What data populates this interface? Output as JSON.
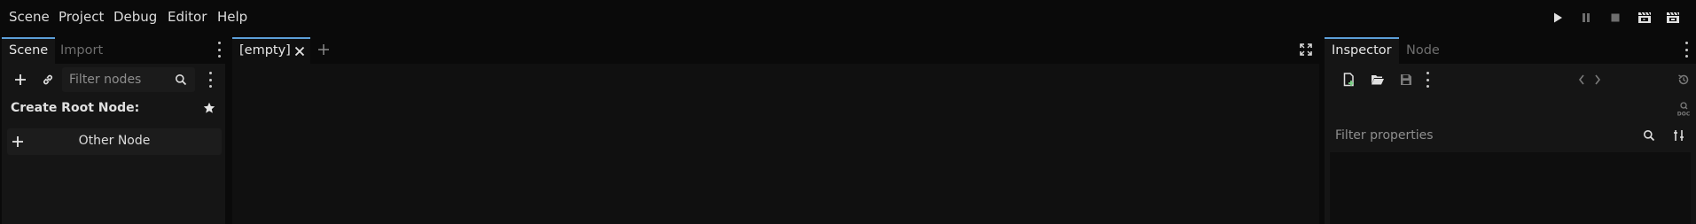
{
  "menubar": {
    "items": [
      "Scene",
      "Project",
      "Debug",
      "Editor",
      "Help"
    ]
  },
  "run_controls": [
    "play-icon",
    "pause-icon",
    "stop-icon",
    "movie-clapper-icon",
    "movie-clapper-alt-icon"
  ],
  "scene_dock": {
    "tabs": [
      {
        "label": "Scene",
        "active": true
      },
      {
        "label": "Import",
        "active": false
      }
    ],
    "filter_placeholder": "Filter nodes",
    "create_root_label": "Create Root Node:",
    "other_node_label": "Other Node"
  },
  "editor": {
    "tabs": [
      {
        "label": "[empty]",
        "active": true
      }
    ]
  },
  "inspector_dock": {
    "tabs": [
      {
        "label": "Inspector",
        "active": true
      },
      {
        "label": "Node",
        "active": false
      }
    ],
    "filter_placeholder": "Filter properties"
  },
  "colors": {
    "accent": "#5c9fd8",
    "background": "#0a0a0a",
    "panel": "#151515",
    "add_icon_green": "#7fd48a"
  }
}
